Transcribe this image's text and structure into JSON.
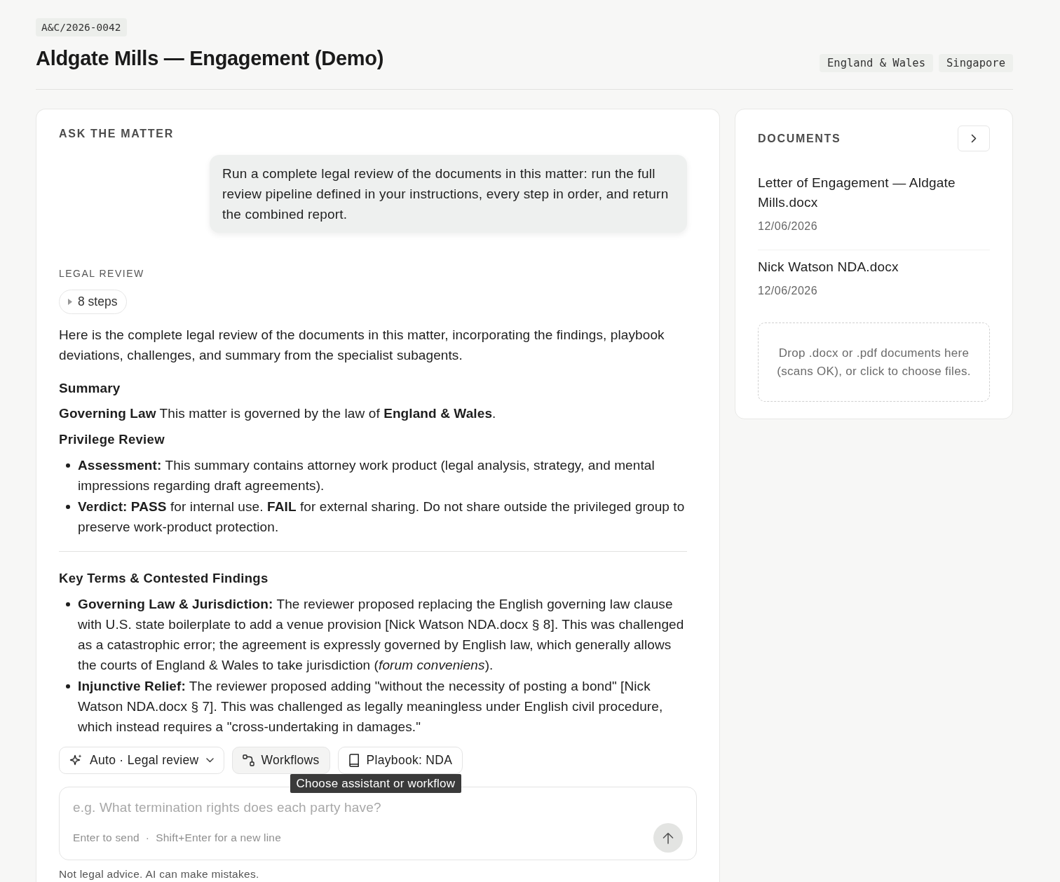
{
  "matter": {
    "reference": "A&C/2026-0042",
    "title": "Aldgate Mills — Engagement (Demo)",
    "jurisdictions": [
      "England & Wales",
      "Singapore"
    ]
  },
  "chat": {
    "heading": "ASK THE MATTER",
    "user_message": "Run a complete legal review of the documents in this matter: run the full review pipeline defined in your instructions, every step in order, and return the combined report.",
    "response": {
      "label": "LEGAL REVIEW",
      "steps": {
        "label": "8 steps",
        "expanded": false
      },
      "blocks": [
        {
          "kind": "paragraph",
          "text": "Here is the complete legal review of the documents in this matter, incorporating the findings, playbook deviations, challenges, and summary from the specialist subagents."
        },
        {
          "kind": "heading",
          "text": "Summary"
        },
        {
          "kind": "paragraph",
          "text": "**Governing Law** This matter is governed by the law of **England & Wales**."
        },
        {
          "kind": "subheading",
          "text": "Privilege Review"
        },
        {
          "kind": "list",
          "items": [
            "**Assessment:** This summary contains attorney work product (legal analysis, strategy, and mental impressions regarding draft agreements).",
            "**Verdict: PASS** for internal use. **FAIL** for external sharing. Do not share outside the privileged group to preserve work-product protection."
          ]
        },
        {
          "kind": "divider"
        },
        {
          "kind": "subheading",
          "text": "Key Terms & Contested Findings"
        },
        {
          "kind": "list",
          "items": [
            "**Governing Law & Jurisdiction:** The reviewer proposed replacing the English governing law clause with U.S. state boilerplate to add a venue provision [Nick Watson NDA.docx § 8]. This was challenged as a catastrophic error; the agreement is expressly governed by English law, which generally allows the courts of England & Wales to take jurisdiction (*forum conveniens*).",
            "**Injunctive Relief:** The reviewer proposed adding \"without the necessity of posting a bond\" [Nick Watson NDA.docx § 7]. This was challenged as legally meaningless under English civil procedure, which instead requires a \"cross-undertaking in damages.\""
          ]
        }
      ]
    }
  },
  "composer": {
    "buttons": [
      {
        "kind": "assistant",
        "label": "Auto · Legal review",
        "hovered": false
      },
      {
        "kind": "workflows",
        "label": "Workflows",
        "hovered": true
      },
      {
        "kind": "playbook",
        "label": "Playbook: NDA",
        "hovered": false
      }
    ],
    "tooltip": "Choose assistant or workflow",
    "placeholder": "e.g. What termination rights does each party have?",
    "hint": "Enter to send  ·  Shift+Enter for a new line",
    "disclaimer": "Not legal advice. AI can make mistakes."
  },
  "documents": {
    "heading": "DOCUMENTS",
    "items": [
      {
        "name": "Letter of Engagement — Aldgate Mills.docx",
        "date": "12/06/2026"
      },
      {
        "name": "Nick Watson NDA.docx",
        "date": "12/06/2026"
      }
    ],
    "drop_zone": "Drop .docx or .pdf documents here (scans OK), or click to choose files."
  }
}
